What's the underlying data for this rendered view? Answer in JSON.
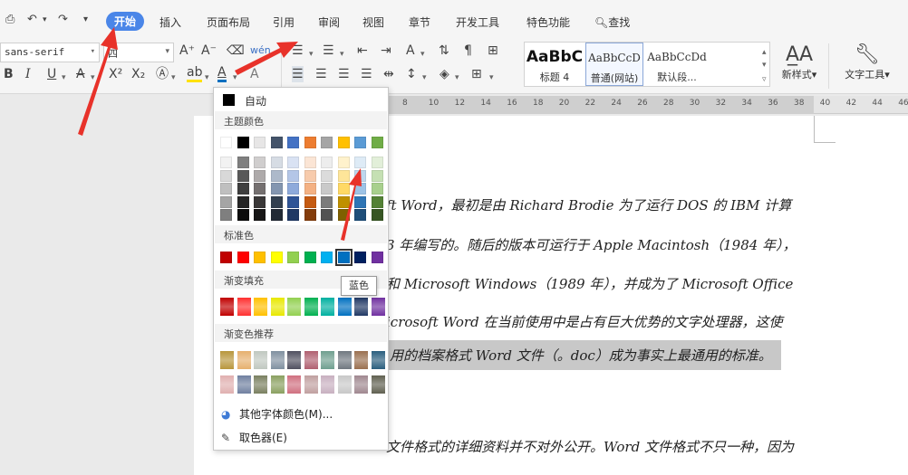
{
  "quick_access": {
    "icons": [
      "preview-icon",
      "undo-icon",
      "undo-dropdown-icon",
      "redo-icon",
      "customize-icon"
    ]
  },
  "menu": {
    "tabs": [
      "开始",
      "插入",
      "页面布局",
      "引用",
      "审阅",
      "视图",
      "章节",
      "开发工具",
      "特色功能"
    ],
    "active": "开始",
    "search_label": "查找"
  },
  "ribbon": {
    "font_name": "sans-serif",
    "font_size": "四",
    "styles": [
      {
        "preview": "AaBbC",
        "name": "标题 4"
      },
      {
        "preview": "AaBbCcD",
        "name": "普通(网站)"
      },
      {
        "preview": "AaBbCcDd",
        "name": "默认段..."
      }
    ],
    "new_style_label": "新样式",
    "text_tools_label": "文字工具"
  },
  "ruler": {
    "ticks": [
      "8",
      "10",
      "12",
      "14",
      "16",
      "18",
      "20",
      "22",
      "24",
      "26",
      "28",
      "30",
      "32",
      "34",
      "36",
      "38",
      "40",
      "42",
      "44",
      "46"
    ]
  },
  "document": {
    "lines": [
      "ft Word，最初是由 Richard Brodie 为了运行 DOS 的 IBM 计算",
      "3 年编写的。随后的版本可运行于 Apple Macintosh（1984 年），",
      "和 Microsoft Windows（1989 年），并成为了 Microsoft Office",
      "icrosoft Word 在当前使用中是占有巨大优势的文字处理器，这使",
      "用的档案格式 Word 文件（。doc）成为事实上最通用的标准。",
      "文件格式的详细资料并不对外公开。Word 文件格式不只一种，因为"
    ]
  },
  "color_picker": {
    "auto_label": "自动",
    "theme_title": "主题颜色",
    "theme_colors": [
      "#ffffff",
      "#000000",
      "#e7e6e6",
      "#44546a",
      "#4472c4",
      "#ed7d31",
      "#a5a5a5",
      "#ffc000",
      "#5b9bd5",
      "#70ad47"
    ],
    "theme_shades": [
      [
        "#f2f2f2",
        "#7f7f7f",
        "#d0cece",
        "#d6dce4",
        "#d9e2f3",
        "#fbe5d5",
        "#ededed",
        "#fff2cc",
        "#deebf6",
        "#e2efd9"
      ],
      [
        "#d8d8d8",
        "#595959",
        "#aeaaaa",
        "#adb9ca",
        "#b4c6e7",
        "#f7cbac",
        "#dbdbdb",
        "#fee599",
        "#bdd7ee",
        "#c5e0b3"
      ],
      [
        "#bfbfbf",
        "#3f3f3f",
        "#757070",
        "#8496b0",
        "#8eaadb",
        "#f4b183",
        "#c9c9c9",
        "#ffd965",
        "#9dc3e6",
        "#a8d08d"
      ],
      [
        "#a5a5a5",
        "#262626",
        "#3a3838",
        "#323f4f",
        "#2f5496",
        "#c55a11",
        "#7b7b7b",
        "#bf9000",
        "#2e75b5",
        "#538135"
      ],
      [
        "#7f7f7f",
        "#0c0c0c",
        "#171616",
        "#222a35",
        "#1f3864",
        "#833c0b",
        "#525252",
        "#7f6000",
        "#1e4e79",
        "#375623"
      ]
    ],
    "standard_title": "标准色",
    "standard_colors": [
      "#c00000",
      "#ff0000",
      "#ffc000",
      "#ffff00",
      "#92d050",
      "#00b050",
      "#00b0f0",
      "#0070c0",
      "#002060",
      "#7030a0"
    ],
    "selected_color_index": 7,
    "tooltip": "蓝色",
    "gradient_title": "渐变填充",
    "gradient_colors": [
      "#c00000",
      "#ff3030",
      "#ffc000",
      "#e8e800",
      "#92d050",
      "#00b050",
      "#00b0a0",
      "#0070c0",
      "#203864",
      "#7030a0"
    ],
    "gradient_rec_title": "渐变色推荐",
    "gradient_rec_row1": [
      "#b8963c",
      "#e6b06e",
      "#c0c8c0",
      "#8090a0",
      "#505060",
      "#b06070",
      "#6f9f8f",
      "#707880",
      "#9a7050",
      "#2a5e7e"
    ],
    "gradient_rec_row2": [
      "#e0b0b0",
      "#7080a0",
      "#7a8060",
      "#8aa060",
      "#d07080",
      "#c0a0a0",
      "#c8b0c0",
      "#c8c8c8",
      "#a08890",
      "#606050"
    ],
    "more_colors_label": "其他字体颜色(M)...",
    "eyedropper_label": "取色器(E)"
  }
}
